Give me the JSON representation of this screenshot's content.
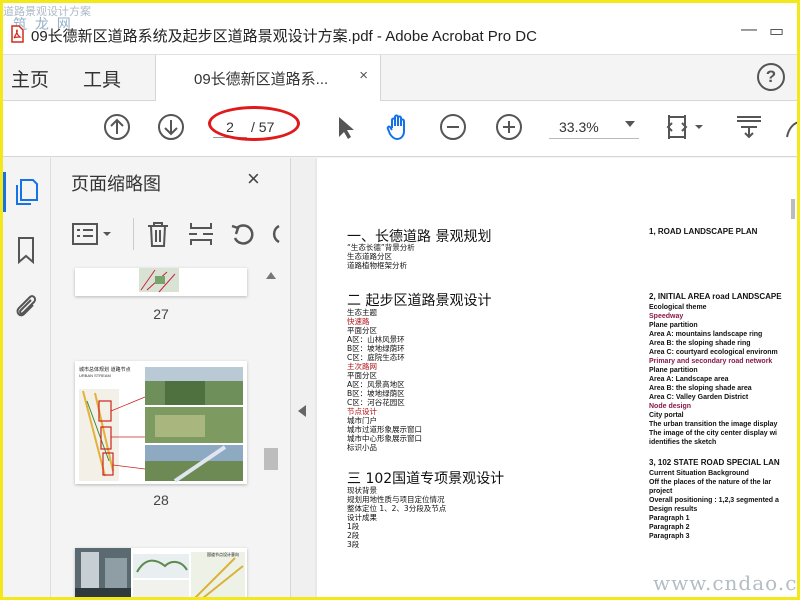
{
  "window": {
    "title": "09长德新区道路系统及起步区道路景观设计方案.pdf - Adobe Acrobat Pro DC",
    "overlay_text_top": "道路景观设计方案",
    "overlay_logo": "筑 龙 网"
  },
  "nav": {
    "home": "主页",
    "tools": "工具"
  },
  "tab": {
    "label": "09长德新区道路系...",
    "close": "×"
  },
  "toolbar": {
    "current_page": "2",
    "total_pages": "/ 57",
    "zoom": "33.3%"
  },
  "panel": {
    "title": "页面缩略图",
    "close": "×",
    "pages": [
      "27",
      "28"
    ],
    "thumb_28_title": "城市总体规划 道路节点",
    "thumb_28_subtitle": "URBAN STREAM",
    "thumb_29_label": "国道节点设计意向"
  },
  "doc": {
    "left": {
      "h1": "一、长德道路 景观规划",
      "s1": [
        "“生态长德”背景分析",
        "生态道路分区",
        "道路植物框架分析"
      ],
      "h2": "二   起步区道路景观设计",
      "s2": [
        {
          "t": "生态主题",
          "c": "black"
        },
        {
          "t": "快速路",
          "c": "red"
        },
        {
          "t": "平面分区",
          "c": "black"
        },
        {
          "t": "   A区：山林风景环",
          "c": "black"
        },
        {
          "t": "   B区：坡地绿荫环",
          "c": "black"
        },
        {
          "t": "   C区：庭院生态环",
          "c": "black"
        },
        {
          "t": "主次路网",
          "c": "red"
        },
        {
          "t": "平面分区",
          "c": "black"
        },
        {
          "t": "   A区：风景高地区",
          "c": "black"
        },
        {
          "t": "   B区：坡地绿荫区",
          "c": "black"
        },
        {
          "t": "   C区：河谷花园区",
          "c": "black"
        },
        {
          "t": "节点设计",
          "c": "red"
        },
        {
          "t": "   城市门户",
          "c": "black"
        },
        {
          "t": "   城市过道形象展示窗口",
          "c": "black"
        },
        {
          "t": "   城市中心形象展示窗口",
          "c": "black"
        },
        {
          "t": "标识小品",
          "c": "black"
        }
      ],
      "h3": "三  102国道专项景观设计",
      "s3": [
        "现状背景",
        "规划用地性质与项目定位情况",
        "整体定位  1、2、3分段及节点",
        "设计成果",
        "1段",
        "2段",
        "3段"
      ]
    },
    "right": {
      "h1": "1, ROAD LANDSCAPE PLAN",
      "h2": "2, INITIAL AREA road LANDSCAPE",
      "s2": [
        {
          "t": "Ecological theme",
          "c": "black"
        },
        {
          "t": "Speedway",
          "c": "red"
        },
        {
          "t": "Plane partition",
          "c": "black"
        },
        {
          "t": "   Area A: mountains landscape ring",
          "c": "black"
        },
        {
          "t": "   Area B: the sloping shade ring",
          "c": "black"
        },
        {
          "t": "   Area C: courtyard ecological environm",
          "c": "black"
        },
        {
          "t": "Primary and secondary road network",
          "c": "red"
        },
        {
          "t": "Plane partition",
          "c": "black"
        },
        {
          "t": "   Area A: Landscape area",
          "c": "black"
        },
        {
          "t": "   Area B: the sloping shade area",
          "c": "black"
        },
        {
          "t": "   Area C: Valley Garden District",
          "c": "black"
        },
        {
          "t": "Node design",
          "c": "red"
        },
        {
          "t": "   City portal",
          "c": "black"
        },
        {
          "t": "   The urban transition the image display",
          "c": "black"
        },
        {
          "t": "   The image of the city center display wi",
          "c": "black"
        },
        {
          "t": "identifies the sketch",
          "c": "black"
        }
      ],
      "h3": "3, 102 STATE ROAD SPECIAL LAN",
      "s3": [
        "Current Situation Background",
        "Off the places of the nature of the lar",
        "project",
        "Overall positioning : 1,2,3 segmented a",
        "Design results",
        "Paragraph 1",
        "Paragraph 2",
        "Paragraph 3"
      ]
    }
  },
  "watermark": "www.cndao.com",
  "colors": {
    "accent": "#1473e6",
    "frame": "#f2e81a",
    "annotation": "#e01a1a",
    "doc_red": "#b0131a"
  },
  "icons": [
    "pdf-icon",
    "minimize-icon",
    "restore-icon",
    "help-icon",
    "prev-page-icon",
    "next-page-icon",
    "select-arrow-icon",
    "hand-icon",
    "zoom-out-icon",
    "zoom-in-icon",
    "fit-page-icon",
    "scroll-mode-icon",
    "rotate-icon",
    "thumbnails-icon",
    "bookmark-icon",
    "attachment-icon",
    "thumb-options-icon",
    "delete-icon",
    "extract-icon",
    "undo-icon"
  ]
}
